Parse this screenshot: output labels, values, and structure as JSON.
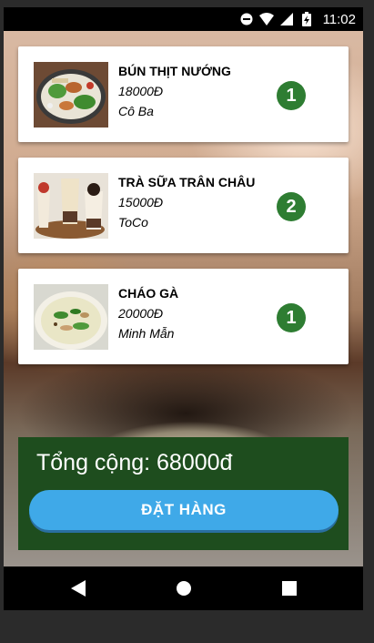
{
  "status_bar": {
    "time": "11:02",
    "icons": [
      "do-not-disturb-icon",
      "wifi-icon",
      "signal-icon",
      "battery-charging-icon"
    ]
  },
  "orders": [
    {
      "name": "BÚN THỊT NƯỚNG",
      "price": "18000Đ",
      "shop": "Cô Ba",
      "quantity": "1",
      "image": "grilled-pork-noodle-image"
    },
    {
      "name": "TRÀ SỮA TRÂN CHÂU",
      "price": "15000Đ",
      "shop": "ToCo",
      "quantity": "2",
      "image": "bubble-milk-tea-image"
    },
    {
      "name": "CHÁO GÀ",
      "price": "20000Đ",
      "shop": "Minh Mẫn",
      "quantity": "1",
      "image": "chicken-porridge-image"
    }
  ],
  "total": {
    "label": "Tổng cộng: 68000đ"
  },
  "order_button": {
    "label": "ĐẶT HÀNG"
  },
  "nav": [
    "back-icon",
    "home-icon",
    "recents-icon"
  ],
  "colors": {
    "quantity_badge": "#2e7d32",
    "total_panel": "#1e4d1e",
    "order_button": "#3fa9e8"
  }
}
